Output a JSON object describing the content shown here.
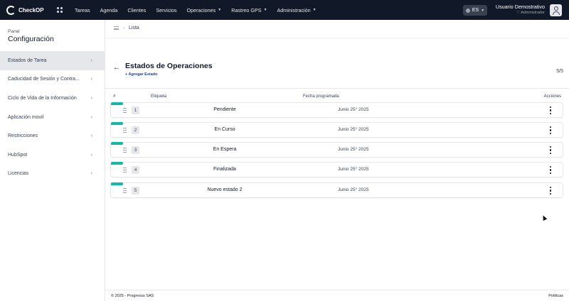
{
  "app": {
    "brand": "CheckOP"
  },
  "nav": {
    "items": [
      {
        "label": "Tareas",
        "dropdown": false
      },
      {
        "label": "Agenda",
        "dropdown": false
      },
      {
        "label": "Clientes",
        "dropdown": false
      },
      {
        "label": "Servicios",
        "dropdown": false
      },
      {
        "label": "Operaciones",
        "dropdown": true
      },
      {
        "label": "Rastreo GPS",
        "dropdown": true
      },
      {
        "label": "Administración",
        "dropdown": true
      }
    ],
    "language": "ES",
    "user_name": "Usuario Demostrativo",
    "user_role": "Administrador"
  },
  "sidebar": {
    "small_label": "Panel",
    "title": "Configuración",
    "items": [
      {
        "label": "Estados de Tarea",
        "active": true
      },
      {
        "label": "Caducidad de Sesión y Contra...",
        "active": false
      },
      {
        "label": "Ciclo de Vida de la Información",
        "active": false
      },
      {
        "label": "Aplicación movil",
        "active": false
      },
      {
        "label": "Restricciones",
        "active": false
      },
      {
        "label": "HubSpot",
        "active": false
      },
      {
        "label": "Licencias",
        "active": false
      }
    ]
  },
  "breadcrumb": {
    "current": "Lista"
  },
  "main": {
    "title": "Estados de Operaciones",
    "add_link": "+ Agregar Estado",
    "count": "5/5",
    "columns": {
      "num": "#",
      "label": "Etiqueta",
      "date": "Fecha programada",
      "actions": "Acciones"
    },
    "rows": [
      {
        "num": "1",
        "label": "Pendiente",
        "date": "Junio 25° 2025"
      },
      {
        "num": "2",
        "label": "En Curso",
        "date": "Junio 25° 2025"
      },
      {
        "num": "3",
        "label": "En Espera",
        "date": "Junio 25° 2025"
      },
      {
        "num": "4",
        "label": "Finalizada",
        "date": "Junio 25° 2025"
      },
      {
        "num": "5",
        "label": "Nuevo estado 2",
        "date": "Junio 25° 2025"
      }
    ]
  },
  "footer": {
    "copyright": "© 2025 - Progresus SAS",
    "link": "Políticas"
  },
  "colors": {
    "topbar": "#111827",
    "accent_tag": "#14b8a6",
    "link": "#1e40af"
  }
}
